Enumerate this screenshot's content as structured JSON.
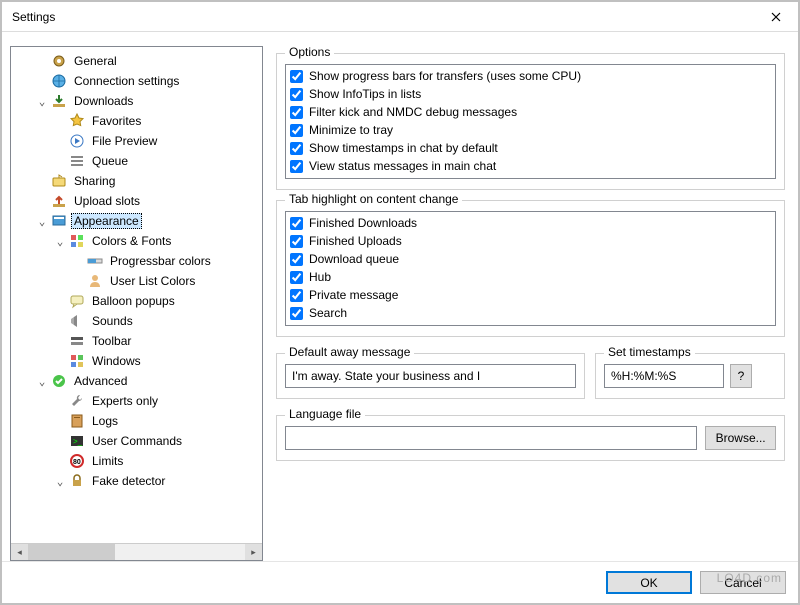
{
  "window": {
    "title": "Settings"
  },
  "tree": [
    {
      "label": "General",
      "icon": "gear",
      "indent": 1,
      "toggle": ""
    },
    {
      "label": "Connection settings",
      "icon": "globe",
      "indent": 1,
      "toggle": ""
    },
    {
      "label": "Downloads",
      "icon": "download",
      "indent": 1,
      "toggle": "expanded"
    },
    {
      "label": "Favorites",
      "icon": "star",
      "indent": 2,
      "toggle": ""
    },
    {
      "label": "File Preview",
      "icon": "play",
      "indent": 2,
      "toggle": ""
    },
    {
      "label": "Queue",
      "icon": "queue",
      "indent": 2,
      "toggle": ""
    },
    {
      "label": "Sharing",
      "icon": "share",
      "indent": 1,
      "toggle": ""
    },
    {
      "label": "Upload slots",
      "icon": "upload",
      "indent": 1,
      "toggle": ""
    },
    {
      "label": "Appearance",
      "icon": "appearance",
      "indent": 1,
      "toggle": "expanded",
      "selected": true
    },
    {
      "label": "Colors & Fonts",
      "icon": "colors",
      "indent": 2,
      "toggle": "expanded"
    },
    {
      "label": "Progressbar colors",
      "icon": "progress",
      "indent": 3,
      "toggle": ""
    },
    {
      "label": "User List Colors",
      "icon": "user",
      "indent": 3,
      "toggle": ""
    },
    {
      "label": "Balloon popups",
      "icon": "balloon",
      "indent": 2,
      "toggle": ""
    },
    {
      "label": "Sounds",
      "icon": "sound",
      "indent": 2,
      "toggle": ""
    },
    {
      "label": "Toolbar",
      "icon": "toolbar",
      "indent": 2,
      "toggle": ""
    },
    {
      "label": "Windows",
      "icon": "windows",
      "indent": 2,
      "toggle": ""
    },
    {
      "label": "Advanced",
      "icon": "check",
      "indent": 1,
      "toggle": "expanded"
    },
    {
      "label": "Experts only",
      "icon": "wrench",
      "indent": 2,
      "toggle": ""
    },
    {
      "label": "Logs",
      "icon": "book",
      "indent": 2,
      "toggle": ""
    },
    {
      "label": "User Commands",
      "icon": "cmd",
      "indent": 2,
      "toggle": ""
    },
    {
      "label": "Limits",
      "icon": "limit",
      "indent": 2,
      "toggle": ""
    },
    {
      "label": "Fake detector",
      "icon": "lock",
      "indent": 2,
      "toggle": "expanded"
    }
  ],
  "options": {
    "legend": "Options",
    "items": [
      {
        "label": "Show progress bars for transfers (uses some CPU)",
        "checked": true
      },
      {
        "label": "Show InfoTips in lists",
        "checked": true
      },
      {
        "label": "Filter kick and NMDC debug messages",
        "checked": true
      },
      {
        "label": "Minimize to tray",
        "checked": true
      },
      {
        "label": "Show timestamps in chat by default",
        "checked": true
      },
      {
        "label": "View status messages in main chat",
        "checked": true
      }
    ]
  },
  "tabHighlight": {
    "legend": "Tab highlight on content change",
    "items": [
      {
        "label": "Finished Downloads",
        "checked": true
      },
      {
        "label": "Finished Uploads",
        "checked": true
      },
      {
        "label": "Download queue",
        "checked": true
      },
      {
        "label": "Hub",
        "checked": true
      },
      {
        "label": "Private message",
        "checked": true
      },
      {
        "label": "Search",
        "checked": true
      }
    ]
  },
  "awayMessage": {
    "legend": "Default away message",
    "value": "I'm away. State your business and I"
  },
  "timestamps": {
    "legend": "Set timestamps",
    "value": "%H:%M:%S",
    "helpLabel": "?"
  },
  "languageFile": {
    "legend": "Language file",
    "value": "",
    "browseLabel": "Browse..."
  },
  "footer": {
    "ok": "OK",
    "cancel": "Cancel"
  },
  "watermark": "LO4D.com"
}
